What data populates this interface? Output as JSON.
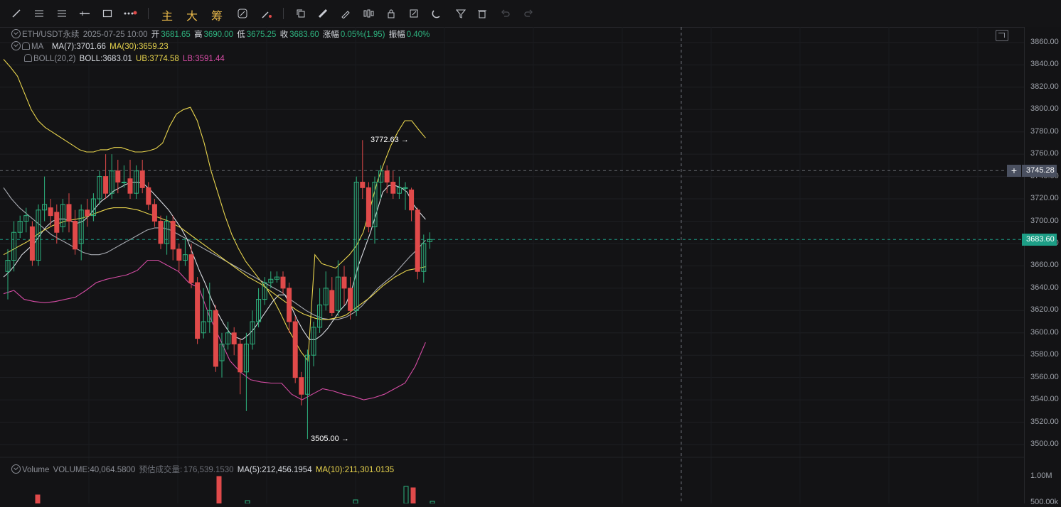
{
  "toolbar": {
    "main_labels": [
      "主",
      "大",
      "筹"
    ]
  },
  "legend": {
    "symbol": "ETH/USDT永续",
    "datetime": "2025-07-25 10:00",
    "open_label": "开",
    "open": "3681.65",
    "high_label": "高",
    "high": "3690.00",
    "low_label": "低",
    "low": "3675.25",
    "close_label": "收",
    "close": "3683.60",
    "change_label": "涨幅",
    "change": "0.05%(1.95)",
    "amp_label": "振幅",
    "amp": "0.40%",
    "ma_name": "MA",
    "ma7": "MA(7):3701.66",
    "ma30": "MA(30):3659.23",
    "boll_name": "BOLL(20,2)",
    "boll": "BOLL:3683.01",
    "ub": "UB:3774.58",
    "lb": "LB:3591.44"
  },
  "volume_legend": {
    "name": "Volume",
    "volume": "VOLUME:40,064.5800",
    "est_label": "预估成交量:",
    "est": "176,539.1530",
    "ma5": "MA(5):212,456.1954",
    "ma10": "MA(10):211,301.0135"
  },
  "price_axis": {
    "ticks": [
      "3860.00",
      "3840.00",
      "3820.00",
      "3800.00",
      "3780.00",
      "3760.00",
      "3740.00",
      "3720.00",
      "3700.00",
      "3680.00",
      "3660.00",
      "3640.00",
      "3620.00",
      "3600.00",
      "3580.00",
      "3560.00",
      "3540.00",
      "3520.00",
      "3500.00"
    ],
    "crosshair_price": "3745.28",
    "last_price": "3683.60",
    "volume_tick": "1.00M",
    "volume_tick2": "500.00k"
  },
  "annotations": {
    "high_mark": "3772.63",
    "low_mark": "3505.00"
  },
  "colors": {
    "up": "#2eb37f",
    "down": "#e04a4a",
    "ma7": "#d9dce2",
    "ma30": "#e8d44d",
    "boll_mid": "#d9dce2",
    "boll_ub": "#e8d44d",
    "boll_lb": "#d64ca5"
  },
  "chart_data": {
    "type": "candlestick",
    "ylim": [
      3490,
      3870
    ],
    "candles": [
      [
        3655,
        3665,
        3630,
        3675
      ],
      [
        3665,
        3690,
        3655,
        3700
      ],
      [
        3690,
        3700,
        3685,
        3705
      ],
      [
        3700,
        3705,
        3690,
        3712
      ],
      [
        3695,
        3665,
        3660,
        3700
      ],
      [
        3665,
        3710,
        3660,
        3715
      ],
      [
        3710,
        3715,
        3700,
        3740
      ],
      [
        3712,
        3705,
        3695,
        3720
      ],
      [
        3708,
        3690,
        3680,
        3715
      ],
      [
        3695,
        3715,
        3690,
        3720
      ],
      [
        3715,
        3700,
        3690,
        3725
      ],
      [
        3700,
        3675,
        3670,
        3710
      ],
      [
        3680,
        3710,
        3665,
        3715
      ],
      [
        3710,
        3705,
        3695,
        3720
      ],
      [
        3705,
        3720,
        3700,
        3725
      ],
      [
        3720,
        3740,
        3715,
        3745
      ],
      [
        3740,
        3725,
        3720,
        3760
      ],
      [
        3725,
        3745,
        3720,
        3760
      ],
      [
        3745,
        3735,
        3725,
        3755
      ],
      [
        3735,
        3735,
        3730,
        3750
      ],
      [
        3738,
        3725,
        3720,
        3755
      ],
      [
        3725,
        3745,
        3720,
        3750
      ],
      [
        3745,
        3730,
        3725,
        3755
      ],
      [
        3730,
        3715,
        3710,
        3735
      ],
      [
        3715,
        3700,
        3695,
        3720
      ],
      [
        3700,
        3680,
        3675,
        3705
      ],
      [
        3680,
        3700,
        3670,
        3705
      ],
      [
        3700,
        3675,
        3665,
        3705
      ],
      [
        3675,
        3665,
        3655,
        3680
      ],
      [
        3665,
        3670,
        3660,
        3685
      ],
      [
        3670,
        3645,
        3640,
        3680
      ],
      [
        3645,
        3595,
        3590,
        3650
      ],
      [
        3600,
        3610,
        3595,
        3640
      ],
      [
        3610,
        3620,
        3600,
        3645
      ],
      [
        3620,
        3570,
        3565,
        3625
      ],
      [
        3575,
        3590,
        3560,
        3600
      ],
      [
        3590,
        3600,
        3585,
        3610
      ],
      [
        3600,
        3590,
        3580,
        3605
      ],
      [
        3590,
        3565,
        3545,
        3595
      ],
      [
        3565,
        3590,
        3530,
        3600
      ],
      [
        3590,
        3610,
        3585,
        3620
      ],
      [
        3610,
        3630,
        3605,
        3640
      ],
      [
        3630,
        3645,
        3625,
        3650
      ],
      [
        3645,
        3648,
        3640,
        3655
      ],
      [
        3648,
        3650,
        3645,
        3655
      ],
      [
        3650,
        3640,
        3635,
        3655
      ],
      [
        3640,
        3610,
        3600,
        3645
      ],
      [
        3610,
        3560,
        3555,
        3615
      ],
      [
        3560,
        3545,
        3535,
        3565
      ],
      [
        3545,
        3580,
        3505,
        3585
      ],
      [
        3580,
        3605,
        3570,
        3610
      ],
      [
        3605,
        3625,
        3600,
        3640
      ],
      [
        3625,
        3640,
        3620,
        3655
      ],
      [
        3638,
        3618,
        3615,
        3650
      ],
      [
        3620,
        3650,
        3615,
        3665
      ],
      [
        3650,
        3640,
        3625,
        3660
      ],
      [
        3640,
        3620,
        3612,
        3650
      ],
      [
        3620,
        3735,
        3615,
        3740
      ],
      [
        3735,
        3730,
        3720,
        3772.63
      ],
      [
        3730,
        3695,
        3690,
        3735
      ],
      [
        3695,
        3735,
        3680,
        3740
      ],
      [
        3735,
        3745,
        3720,
        3750
      ],
      [
        3745,
        3735,
        3725,
        3750
      ],
      [
        3735,
        3725,
        3720,
        3745
      ],
      [
        3725,
        3730,
        3720,
        3740
      ],
      [
        3730,
        3730,
        3710,
        3735
      ],
      [
        3728,
        3710,
        3700,
        3730
      ],
      [
        3710,
        3655,
        3648,
        3712
      ],
      [
        3655,
        3680,
        3645,
        3688
      ],
      [
        3681.65,
        3683.6,
        3675.25,
        3690
      ]
    ],
    "ma7": [
      3650,
      3655,
      3662,
      3670,
      3675,
      3680,
      3688,
      3695,
      3700,
      3702,
      3702,
      3700,
      3698,
      3700,
      3705,
      3712,
      3718,
      3722,
      3727,
      3730,
      3733,
      3735,
      3735,
      3733,
      3728,
      3722,
      3716,
      3710,
      3702,
      3694,
      3684,
      3670,
      3656,
      3644,
      3630,
      3618,
      3608,
      3600,
      3596,
      3594,
      3598,
      3604,
      3612,
      3620,
      3628,
      3634,
      3634,
      3624,
      3612,
      3602,
      3594,
      3594,
      3598,
      3604,
      3612,
      3620,
      3626,
      3640,
      3660,
      3675,
      3690,
      3708,
      3726,
      3732,
      3732,
      3730,
      3726,
      3715,
      3708,
      3701.66
    ],
    "ma30": [
      3670,
      3673,
      3676,
      3679,
      3682,
      3686,
      3690,
      3693,
      3696,
      3698,
      3700,
      3701,
      3702,
      3703,
      3705,
      3707,
      3709,
      3711,
      3712,
      3712,
      3712,
      3711,
      3710,
      3708,
      3706,
      3704,
      3702,
      3700,
      3697,
      3694,
      3690,
      3686,
      3682,
      3678,
      3674,
      3670,
      3666,
      3662,
      3658,
      3654,
      3650,
      3647,
      3644,
      3640,
      3636,
      3632,
      3628,
      3624,
      3620,
      3617,
      3615,
      3613,
      3612,
      3612,
      3613,
      3614,
      3616,
      3620,
      3624,
      3628,
      3632,
      3637,
      3642,
      3646,
      3650,
      3653,
      3656,
      3657,
      3658,
      3659.23
    ],
    "boll_ub": [
      3845,
      3838,
      3830,
      3815,
      3800,
      3790,
      3784,
      3780,
      3776,
      3772,
      3768,
      3764,
      3762,
      3762,
      3764,
      3764,
      3766,
      3766,
      3764,
      3762,
      3762,
      3763,
      3765,
      3770,
      3785,
      3796,
      3800,
      3802,
      3790,
      3770,
      3745,
      3725,
      3705,
      3688,
      3675,
      3664,
      3656,
      3648,
      3640,
      3630,
      3618,
      3605,
      3594,
      3583,
      3575,
      3670,
      3662,
      3660,
      3658,
      3664,
      3670,
      3678,
      3690,
      3712,
      3735,
      3752,
      3768,
      3780,
      3790,
      3790,
      3782,
      3774.58
    ],
    "boll_mid": [
      3730,
      3720,
      3712,
      3706,
      3700,
      3694,
      3688,
      3684,
      3680,
      3676,
      3672,
      3670,
      3670,
      3672,
      3676,
      3680,
      3684,
      3688,
      3692,
      3694,
      3694,
      3692,
      3688,
      3684,
      3680,
      3676,
      3672,
      3668,
      3664,
      3660,
      3656,
      3652,
      3648,
      3644,
      3640,
      3636,
      3630,
      3625,
      3620,
      3616,
      3613,
      3612,
      3612,
      3614,
      3618,
      3624,
      3632,
      3640,
      3646,
      3652,
      3660,
      3668,
      3675,
      3683.01
    ],
    "boll_lb": [
      3635,
      3638,
      3630,
      3628,
      3627,
      3628,
      3630,
      3632,
      3638,
      3645,
      3648,
      3650,
      3652,
      3656,
      3665,
      3665,
      3660,
      3655,
      3645,
      3640,
      3615,
      3595,
      3575,
      3565,
      3558,
      3556,
      3555,
      3555,
      3545,
      3540,
      3545,
      3550,
      3548,
      3545,
      3543,
      3540,
      3542,
      3545,
      3550,
      3555,
      3570,
      3591.44
    ]
  }
}
